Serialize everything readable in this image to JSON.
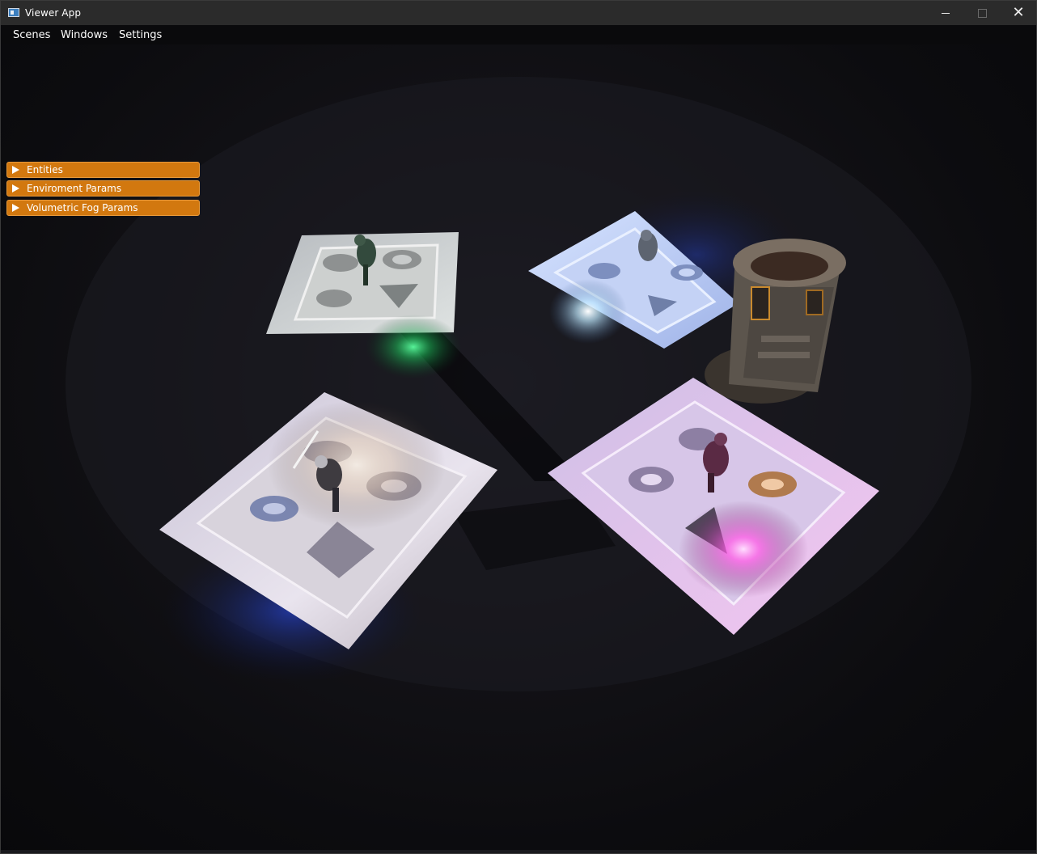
{
  "window": {
    "title": "Viewer App",
    "close_glyph": "✕"
  },
  "menu": {
    "items": [
      "Scenes",
      "Windows",
      "Settings"
    ]
  },
  "panels": [
    {
      "label": "Entities",
      "expanded": false
    },
    {
      "label": "Enviroment Params",
      "expanded": false
    },
    {
      "label": "Volumetric Fog Params",
      "expanded": false
    }
  ],
  "colors": {
    "panel_header": "#d2780f",
    "light_green": "#2fd16a",
    "light_cyan": "#bfe9ff",
    "light_magenta": "#ff4fe0",
    "light_warm": "#ffe8c8",
    "light_blue": "#2a4cff"
  },
  "icons": {
    "app": "viewer-app-icon",
    "minimize": "minimize-icon",
    "maximize": "maximize-icon",
    "close": "close-icon",
    "panel_toggle": "triangle-right-icon"
  }
}
